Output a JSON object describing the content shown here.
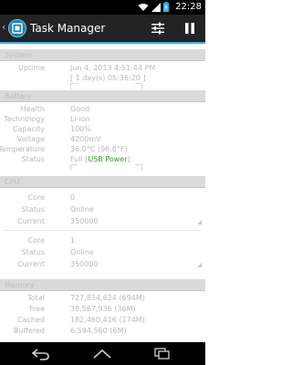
{
  "status_bar": {
    "time": "22:28"
  },
  "action_bar": {
    "title": "Task Manager"
  },
  "sections": {
    "system": {
      "header": "System",
      "uptime_label": "Uptime",
      "uptime_value": "Jun 4, 2013 4:51:44 PM",
      "uptime_duration": "[ 1 day(s) 05:36:20 ]"
    },
    "battery": {
      "header": "Battery",
      "rows": [
        {
          "label": "Health",
          "value": "Good"
        },
        {
          "label": "Technology",
          "value": "Li-ion"
        },
        {
          "label": "Capacity",
          "value": "100%"
        },
        {
          "label": "Voltage",
          "value": "4200mV"
        },
        {
          "label": "Temperature",
          "value": "36.0°C (96.8°F)"
        }
      ],
      "status_label": "Status",
      "status_value": "Full",
      "status_source": "USB Power"
    },
    "cpu": {
      "header": "CPU",
      "cores": [
        {
          "core_label": "Core",
          "core_value": "0",
          "status_label": "Status",
          "status_value": "Online",
          "current_label": "Current",
          "current_value": "350000"
        },
        {
          "core_label": "Core",
          "core_value": "1",
          "status_label": "Status",
          "status_value": "Online",
          "current_label": "Current",
          "current_value": "350000"
        }
      ]
    },
    "memory": {
      "header": "Memory",
      "rows": [
        {
          "label": "Total",
          "value": "727,834,624 (694M)"
        },
        {
          "label": "Free",
          "value": "38,567,936 (36M)"
        },
        {
          "label": "Cached",
          "value": "182,460,416 (174M)"
        },
        {
          "label": "Buffered",
          "value": "6,594,560 (6M)"
        }
      ]
    }
  },
  "colors": {
    "accent": "#33b5e5",
    "status_green": "#2f9b2f",
    "app_icon": "#1d7fb2"
  },
  "icons": [
    "wifi-icon",
    "signal-icon",
    "battery-icon",
    "app-icon",
    "settings-sliders-icon",
    "pause-icon",
    "nav-back-icon",
    "nav-home-icon",
    "nav-recents-icon"
  ]
}
